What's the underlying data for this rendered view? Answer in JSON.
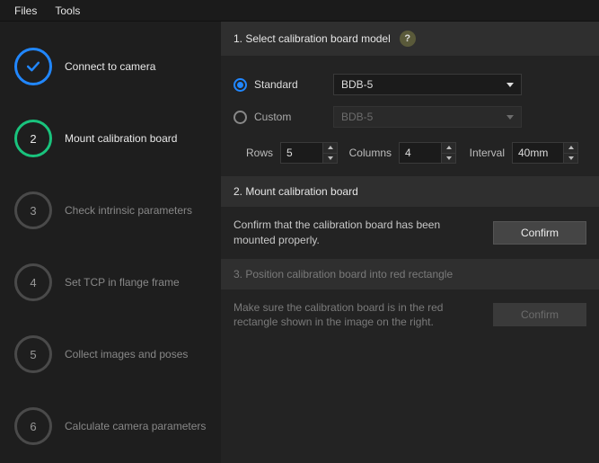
{
  "menu": {
    "files": "Files",
    "tools": "Tools"
  },
  "steps": [
    {
      "num": "",
      "label": "Connect to camera",
      "state": "done"
    },
    {
      "num": "2",
      "label": "Mount calibration board",
      "state": "current"
    },
    {
      "num": "3",
      "label": "Check intrinsic parameters",
      "state": "pending"
    },
    {
      "num": "4",
      "label": "Set TCP in flange frame",
      "state": "pending"
    },
    {
      "num": "5",
      "label": "Collect images and poses",
      "state": "pending"
    },
    {
      "num": "6",
      "label": "Calculate camera parameters",
      "state": "pending"
    }
  ],
  "section1": {
    "title": "1. Select calibration board model",
    "help": "?",
    "standard": {
      "label": "Standard",
      "value": "BDB-5"
    },
    "custom": {
      "label": "Custom",
      "value": "BDB-5"
    },
    "rows": {
      "label": "Rows",
      "value": "5"
    },
    "columns": {
      "label": "Columns",
      "value": "4"
    },
    "interval": {
      "label": "Interval",
      "value": "40mm"
    }
  },
  "section2": {
    "title": "2. Mount calibration board",
    "text": "Confirm that the calibration board has been mounted properly.",
    "button": "Confirm"
  },
  "section3": {
    "title": "3. Position calibration board into red rectangle",
    "text": "Make sure the calibration board is in the red rectangle shown in the image on the right.",
    "button": "Confirm"
  }
}
